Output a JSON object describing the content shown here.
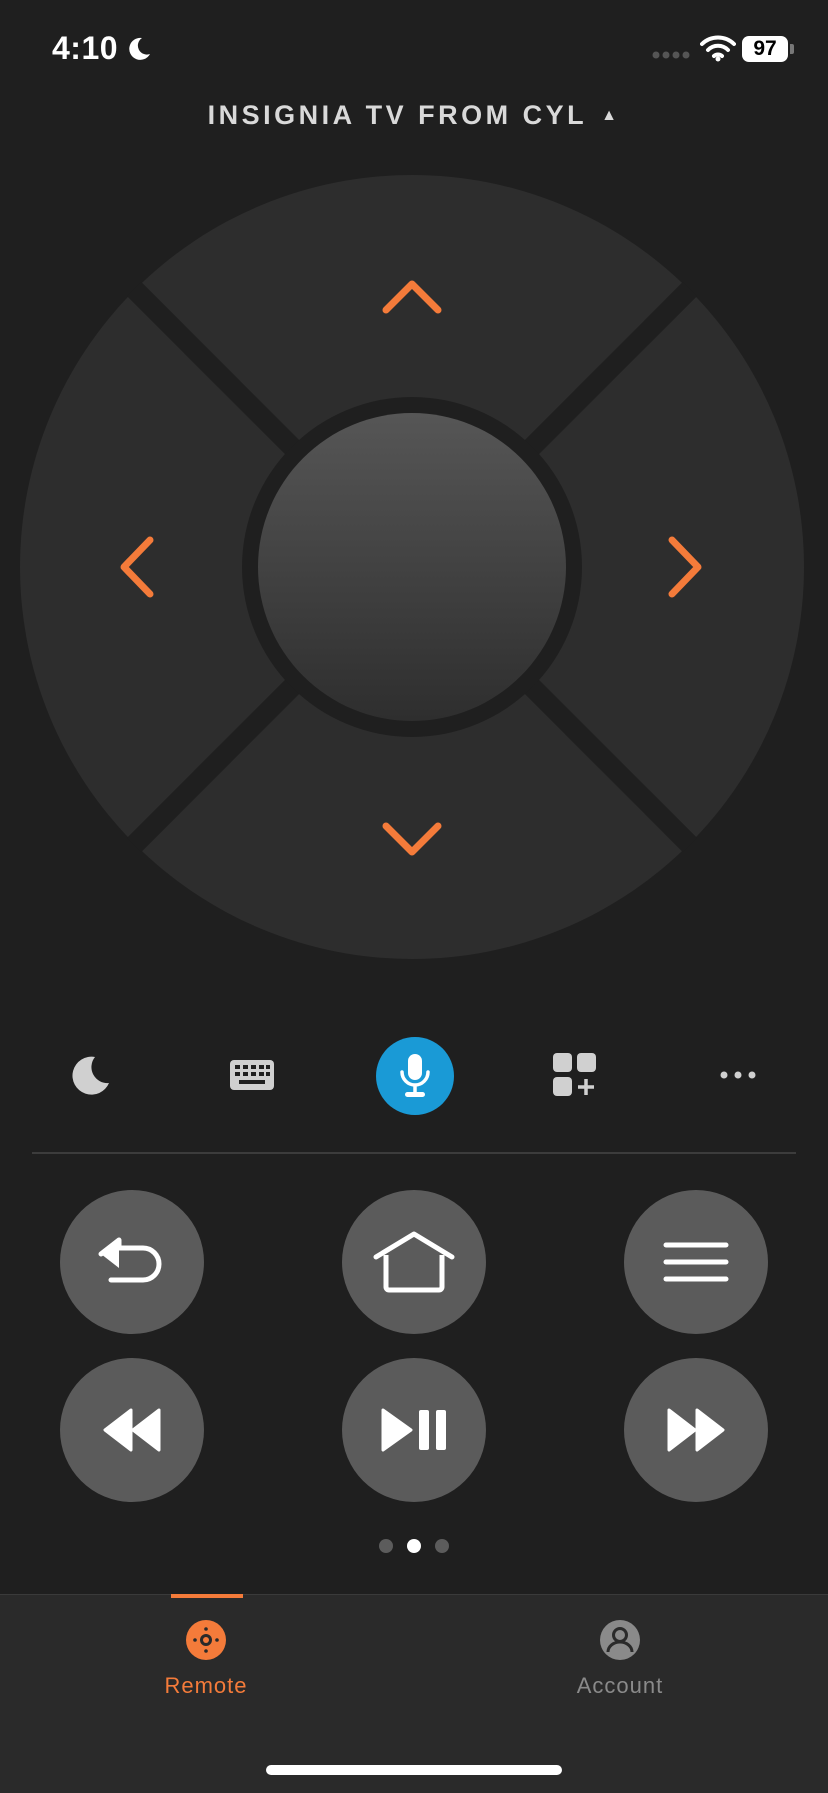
{
  "status_bar": {
    "time": "4:10",
    "battery_level": "97"
  },
  "device": {
    "name": "INSIGNIA TV FROM CYL"
  },
  "colors": {
    "accent": "#f47b3a",
    "mic": "#1a9ad6",
    "background": "#1f1f1f"
  },
  "toolbar": {
    "items": [
      "moon-icon",
      "keyboard-icon",
      "microphone-icon",
      "apps-add-icon",
      "more-icon"
    ]
  },
  "buttons": {
    "row1": [
      "back-icon",
      "home-icon",
      "menu-icon"
    ],
    "row2": [
      "rewind-icon",
      "play-pause-icon",
      "fast-forward-icon"
    ]
  },
  "pagination": {
    "total": 3,
    "active_page": 2
  },
  "tabs": [
    {
      "label": "Remote",
      "icon": "remote-icon",
      "active": true
    },
    {
      "label": "Account",
      "icon": "account-icon",
      "active": false
    }
  ]
}
